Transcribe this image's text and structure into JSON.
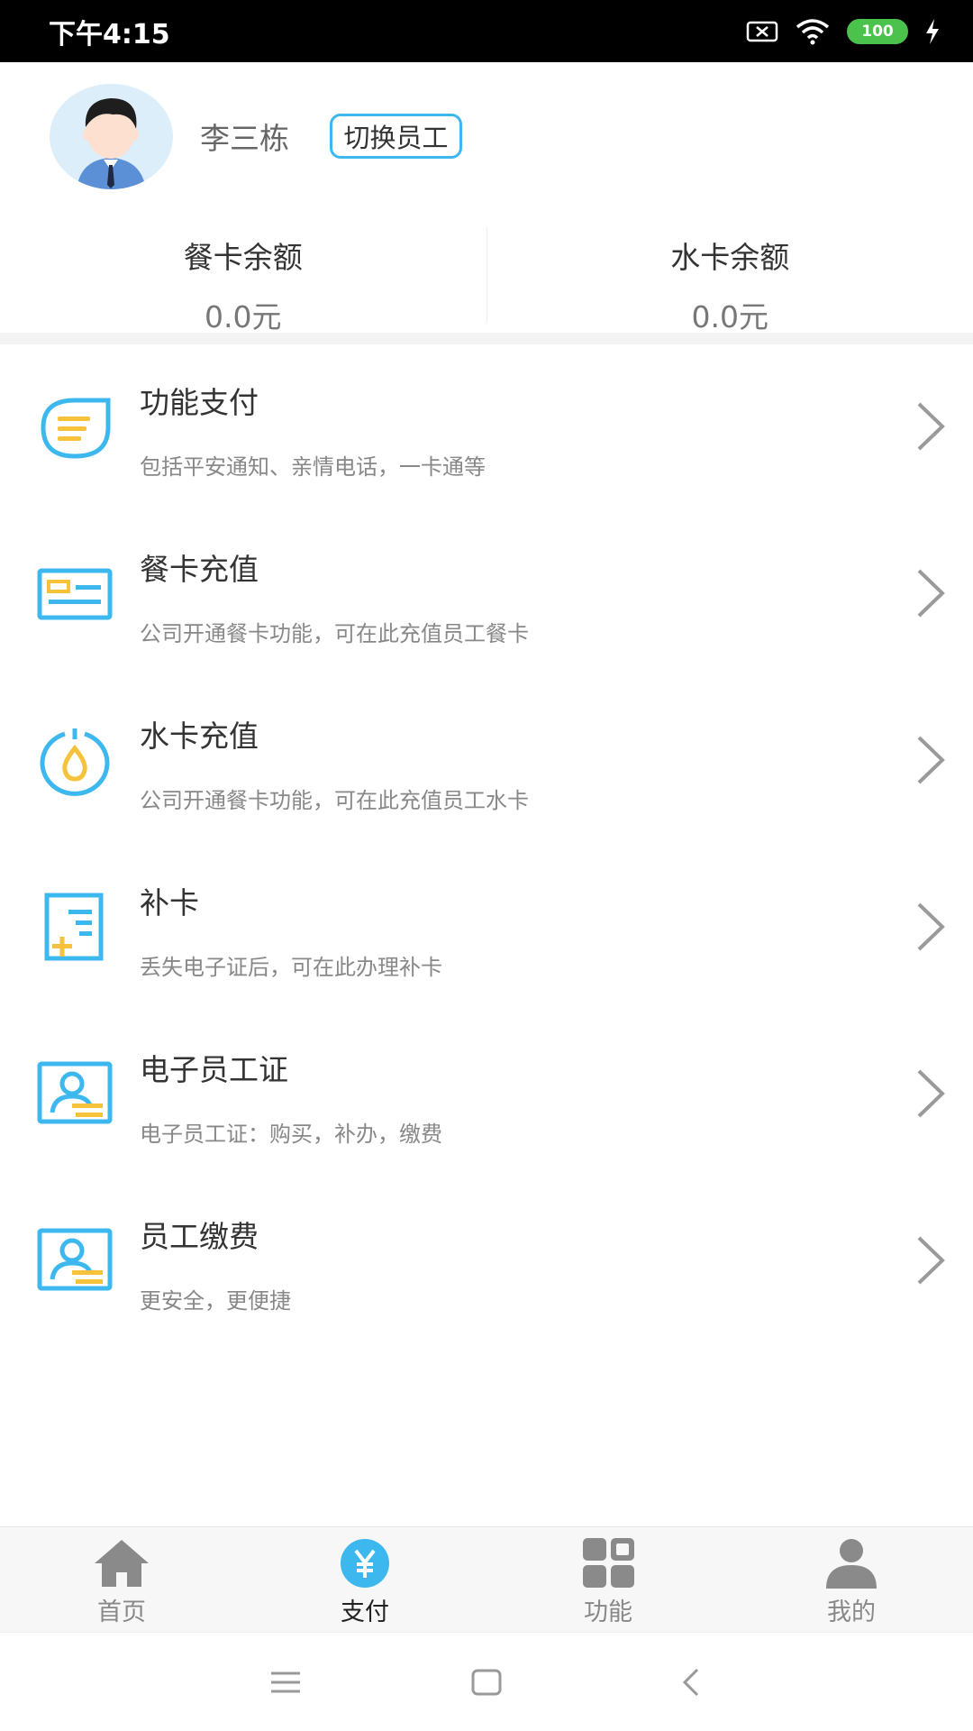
{
  "status_bar": {
    "time": "下午4:15",
    "battery": "100"
  },
  "profile": {
    "name": "李三栋",
    "switch_label": "切换员工"
  },
  "balances": [
    {
      "title": "餐卡余额",
      "value": "0.0元"
    },
    {
      "title": "水卡余额",
      "value": "0.0元"
    }
  ],
  "menu": [
    {
      "title": "功能支付",
      "desc": "包括平安通知、亲情电话，一卡通等",
      "icon": "chat-list-icon"
    },
    {
      "title": "餐卡充值",
      "desc": "公司开通餐卡功能，可在此充值员工餐卡",
      "icon": "card-icon"
    },
    {
      "title": "水卡充值",
      "desc": "公司开通餐卡功能，可在此充值员工水卡",
      "icon": "water-drop-icon"
    },
    {
      "title": "补卡",
      "desc": "丢失电子证后，可在此办理补卡",
      "icon": "doc-plus-icon"
    },
    {
      "title": "电子员工证",
      "desc": "电子员工证：购买，补办，缴费",
      "icon": "id-card-icon"
    },
    {
      "title": "员工缴费",
      "desc": "更安全，更便捷",
      "icon": "id-card-icon"
    }
  ],
  "tabs": [
    {
      "label": "首页",
      "icon": "home-icon"
    },
    {
      "label": "支付",
      "icon": "yuan-icon"
    },
    {
      "label": "功能",
      "icon": "grid-icon"
    },
    {
      "label": "我的",
      "icon": "person-icon"
    }
  ],
  "colors": {
    "accent": "#3cb8ef",
    "highlight": "#f7c23b",
    "battery": "#4bc24b"
  }
}
